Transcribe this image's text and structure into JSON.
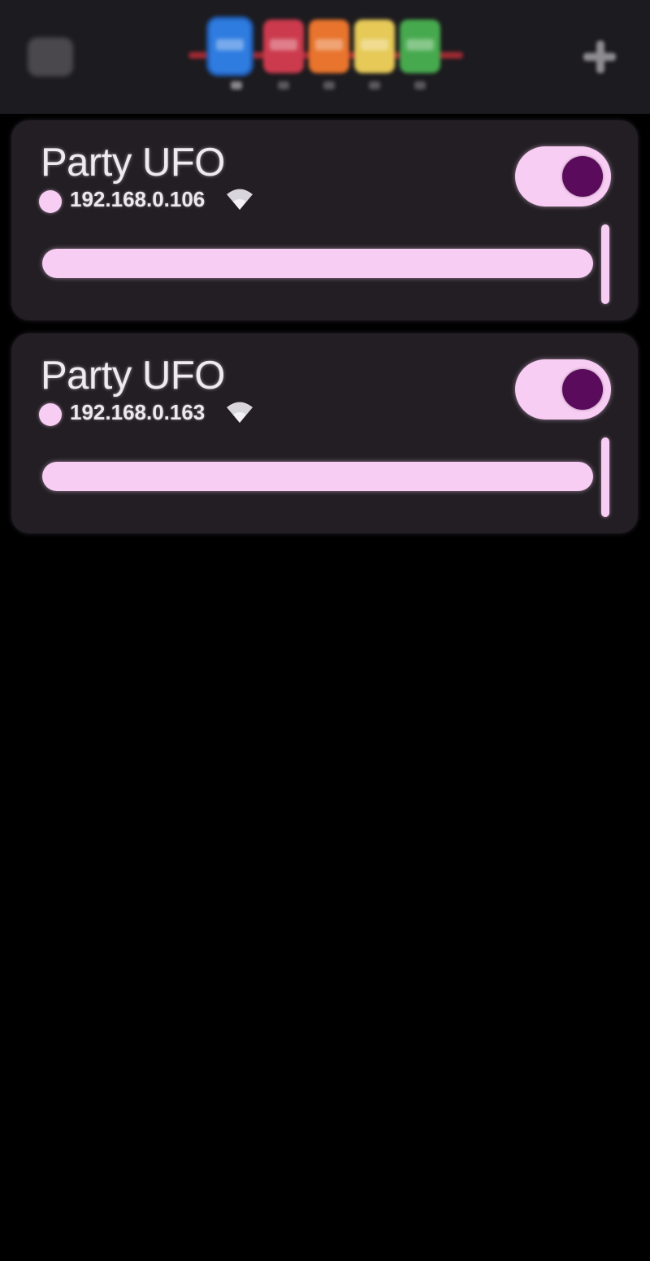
{
  "colors": {
    "background": "#000000",
    "topbar": "#1c1b1f",
    "card": "#231e24",
    "accent": "#f8cdf3",
    "toggle_knob": "#5a0b5b",
    "text": "#eeeaf1"
  },
  "topbar": {
    "menu_icon": "menu-icon",
    "add_icon": "plus-icon",
    "groups": [
      {
        "label": "1",
        "color": "#2f7ce0"
      },
      {
        "label": "2",
        "color": "#cc3b4d"
      },
      {
        "label": "3",
        "color": "#e8742d"
      },
      {
        "label": "4",
        "color": "#e6c957"
      },
      {
        "label": "5",
        "color": "#47a94e"
      }
    ]
  },
  "devices": [
    {
      "name": "Party UFO",
      "ip": "192.168.0.106",
      "connection_icon": "wifi-icon",
      "power_on": true,
      "brightness": 1.0
    },
    {
      "name": "Party UFO",
      "ip": "192.168.0.163",
      "connection_icon": "wifi-icon",
      "power_on": true,
      "brightness": 1.0
    }
  ]
}
